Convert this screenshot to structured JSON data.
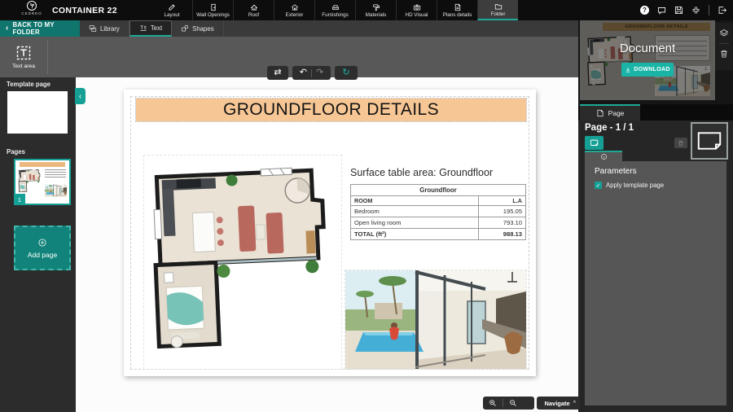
{
  "app": {
    "logo_text": "CEDREO",
    "project_title": "CONTAINER 22",
    "top_tabs": [
      "Layout",
      "Wall Openings",
      "Roof",
      "Exterior",
      "Furnishings",
      "Materials",
      "HD Visual",
      "Plans details",
      "Folder"
    ],
    "active_top_tab": "Folder"
  },
  "subnav": {
    "back_label": "BACK TO MY FOLDER",
    "tabs": [
      "Library",
      "Text",
      "Shapes"
    ],
    "active_tab": "Text"
  },
  "tools": {
    "text_area_label": "Text area"
  },
  "left_panel": {
    "template_page_label": "Template page",
    "pages_label": "Pages",
    "page_number": "1",
    "add_page_label": "Add page"
  },
  "document": {
    "title": "GROUNDFLOOR DETAILS",
    "surface_heading": "Surface table area: Groundfloor",
    "table": {
      "header": "Groundfloor",
      "columns": [
        "ROOM",
        "L.A"
      ],
      "rows": [
        [
          "Bedroom",
          "195.05"
        ],
        [
          "Open living room",
          "793.10"
        ]
      ],
      "total_label": "TOTAL (ft²)",
      "total_value": "988.13"
    }
  },
  "canvas_controls": {
    "navigate_label": "Navigate"
  },
  "right_panel": {
    "preview_title": "GROUNDFLOOR DETAILS",
    "document_label": "Document",
    "download_label": "DOWNLOAD",
    "page_tab_label": "Page",
    "page_indicator": "Page - 1 / 1",
    "parameters_label": "Parameters",
    "apply_template_label": "Apply template page"
  },
  "icons": {
    "swap": "⇄",
    "undo": "↶",
    "redo": "↷",
    "refresh": "↻",
    "chevron_left": "‹",
    "help": "?",
    "caret_up": "^",
    "check": "✓"
  },
  "colors": {
    "accent": "#16a095",
    "accent_bright": "#19b4a6",
    "teal_dark": "#0f756d",
    "banner": "#f6c795",
    "preview_banner": "#a8874e"
  }
}
